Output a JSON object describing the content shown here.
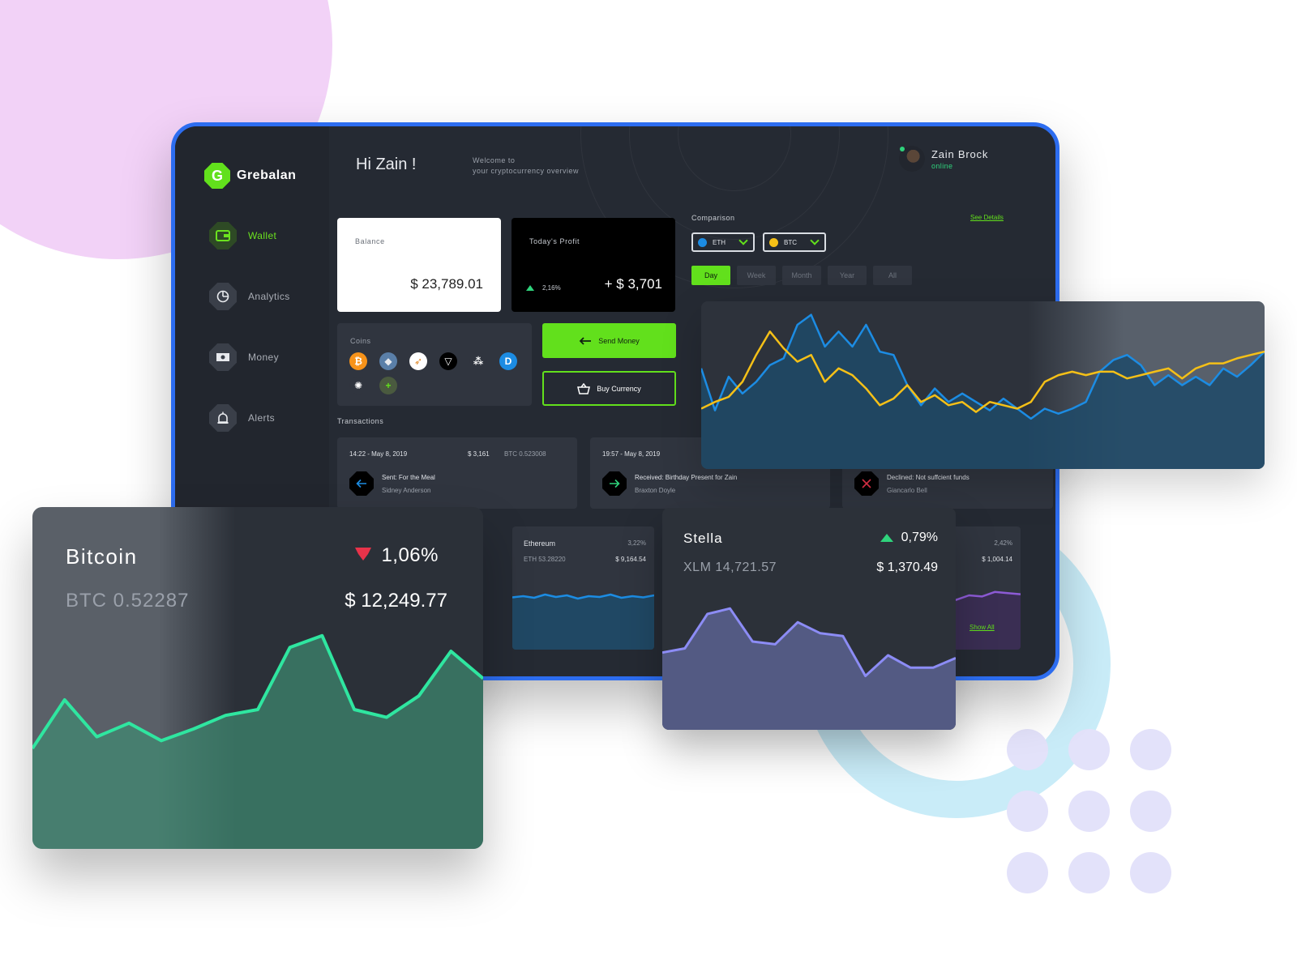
{
  "app": {
    "brand": "Grebalan",
    "brand_initial": "G",
    "greeting": "Hi Zain !",
    "welcome_line1": "Welcome to",
    "welcome_line2": "your cryptocurrency overview"
  },
  "user": {
    "name": "Zain Brock",
    "status": "online"
  },
  "sidebar": {
    "items": [
      {
        "label": "Wallet",
        "icon": "wallet-icon",
        "active": true
      },
      {
        "label": "Analytics",
        "icon": "pie-chart-icon",
        "active": false
      },
      {
        "label": "Money",
        "icon": "banknote-icon",
        "active": false
      },
      {
        "label": "Alerts",
        "icon": "alarm-icon",
        "active": false
      }
    ]
  },
  "balance": {
    "label": "Balance",
    "value": "$ 23,789.01"
  },
  "profit": {
    "label": "Today's Profit",
    "change": "2,16%",
    "value": "+ $ 3,701"
  },
  "coins": {
    "label": "Coins",
    "items": [
      {
        "name": "bitcoin-coin-icon",
        "color": "#f7931a",
        "glyph": "₿"
      },
      {
        "name": "ethereum-coin-icon",
        "color": "#5a7fa8",
        "glyph": "◆"
      },
      {
        "name": "rocket-coin-icon",
        "color": "#ffffff",
        "glyph": "➶"
      },
      {
        "name": "tron-coin-icon",
        "color": "#000000",
        "glyph": "▽"
      },
      {
        "name": "iota-coin-icon",
        "color": "#30353f",
        "glyph": "⁂"
      },
      {
        "name": "dash-coin-icon",
        "color": "#1c8ce3",
        "glyph": "D"
      },
      {
        "name": "cardano-coin-icon",
        "color": "#30353f",
        "glyph": "✺"
      },
      {
        "name": "add-coin-icon",
        "color": "#4a5a3f",
        "glyph": "+"
      }
    ]
  },
  "actions": {
    "send": "Send Money",
    "buy": "Buy Currency"
  },
  "transactions": {
    "label": "Transactions",
    "items": [
      {
        "time": "14:22 - May 8, 2019",
        "amount": "$ 3,161",
        "btc": "BTC 0.523008",
        "title": "Sent: For the Meal",
        "person": "Sidney Anderson",
        "type": "sent"
      },
      {
        "time": "19:57 - May 8, 2019",
        "amount": "",
        "btc": "",
        "title": "Received: Birthday Present for Zain",
        "person": "Braxton Doyle",
        "type": "received"
      },
      {
        "time": "",
        "amount": "",
        "btc": "",
        "title": "Declined: Not suffcient funds",
        "person": "Giancarlo Bell",
        "type": "declined"
      }
    ]
  },
  "comparison": {
    "label": "Comparison",
    "see_details": "See Details",
    "select_a": {
      "value": "ETH",
      "color": "#1c8ce3"
    },
    "select_b": {
      "value": "BTC",
      "color": "#f5c017"
    },
    "ranges": [
      "Day",
      "Week",
      "Month",
      "Year",
      "All"
    ],
    "active_range": "Day"
  },
  "mini_cards": {
    "ethereum": {
      "name": "Ethereum",
      "sub": "ETH 53.28220",
      "pct": "3,22%",
      "price": "$ 9,164.54"
    },
    "right": {
      "pct": "2,42%",
      "price": "$ 1,004.14"
    },
    "show_all": "Show All"
  },
  "bitcoin_card": {
    "title": "Bitcoin",
    "sub": "BTC 0.52287",
    "pct": "1,06%",
    "price": "$ 12,249.77"
  },
  "stella_card": {
    "title": "Stella",
    "sub": "XLM 14,721.57",
    "pct": "0,79%",
    "price": "$ 1,370.49"
  },
  "colors": {
    "accent": "#62e01c",
    "frame": "#2d6df0",
    "positive": "#2fd37c",
    "negative": "#e8334a",
    "eth": "#1c8ce3",
    "btc": "#f5c017"
  },
  "chart_data": [
    {
      "type": "line",
      "title": "",
      "series": [
        {
          "name": "ETH",
          "values": [
            60,
            35,
            55,
            45,
            52,
            62,
            66,
            86,
            92,
            73,
            82,
            73,
            86,
            70,
            68,
            50,
            38,
            48,
            40,
            45,
            40,
            35,
            42,
            36,
            30,
            36,
            33,
            36,
            40,
            58,
            65,
            68,
            62,
            50,
            56,
            50,
            55,
            50,
            60,
            55,
            62,
            70
          ]
        },
        {
          "name": "BTC",
          "values": [
            36,
            40,
            43,
            52,
            68,
            82,
            72,
            64,
            68,
            52,
            60,
            56,
            48,
            38,
            42,
            50,
            40,
            44,
            38,
            40,
            34,
            40,
            38,
            36,
            40,
            52,
            56,
            58,
            56,
            58,
            58,
            54,
            56,
            58,
            60,
            54,
            60,
            63,
            63,
            66,
            68,
            70
          ]
        }
      ]
    },
    {
      "type": "area",
      "title": "",
      "series": [
        {
          "values": [
            30,
            55,
            36,
            43,
            34,
            40,
            47,
            50,
            82,
            88,
            50,
            46,
            57,
            80,
            66
          ]
        }
      ]
    },
    {
      "type": "area",
      "title": "",
      "series": [
        {
          "values": [
            42,
            45,
            70,
            74,
            50,
            48,
            64,
            56,
            54,
            25,
            40,
            31,
            31,
            38
          ]
        }
      ]
    },
    {
      "type": "area",
      "title": "",
      "series": [
        {
          "values": [
            45,
            48,
            44,
            52,
            46,
            50,
            42,
            48,
            46,
            52,
            44,
            48,
            45,
            50
          ]
        }
      ]
    },
    {
      "type": "area",
      "title": "",
      "series": [
        {
          "values": [
            30,
            32,
            28,
            36,
            34,
            44,
            42,
            50,
            48,
            56,
            54,
            52
          ]
        }
      ]
    }
  ]
}
